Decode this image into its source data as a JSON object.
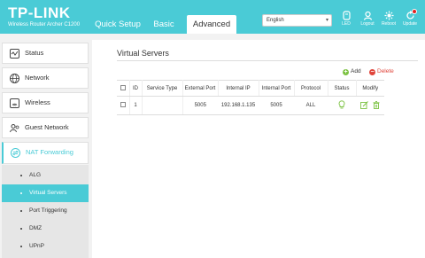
{
  "brand": {
    "logo": "TP-LINK",
    "model": "Wireless Router Archer C1200"
  },
  "tabs": [
    {
      "label": "Quick Setup"
    },
    {
      "label": "Basic"
    },
    {
      "label": "Advanced"
    }
  ],
  "language": {
    "selected": "English"
  },
  "header_buttons": [
    {
      "label": "LED",
      "icon": "led-icon"
    },
    {
      "label": "Logout",
      "icon": "logout-icon"
    },
    {
      "label": "Reboot",
      "icon": "reboot-icon"
    },
    {
      "label": "Update",
      "icon": "update-icon"
    }
  ],
  "sidebar": {
    "items": [
      {
        "label": "Status",
        "icon": "status-icon"
      },
      {
        "label": "Network",
        "icon": "globe-icon"
      },
      {
        "label": "Wireless",
        "icon": "wireless-icon"
      },
      {
        "label": "Guest Network",
        "icon": "guest-icon"
      },
      {
        "label": "NAT Forwarding",
        "icon": "nat-icon"
      }
    ],
    "sub_items": [
      {
        "label": "ALG"
      },
      {
        "label": "Virtual Servers"
      },
      {
        "label": "Port Triggering"
      },
      {
        "label": "DMZ"
      },
      {
        "label": "UPnP"
      }
    ]
  },
  "main": {
    "title": "Virtual Servers",
    "add_label": "Add",
    "delete_label": "Delete",
    "help_label": "?",
    "columns": [
      "ID",
      "Service Type",
      "External Port",
      "Internal IP",
      "Internal Port",
      "Protocol",
      "Status",
      "Modify"
    ],
    "rows": [
      {
        "id": "1",
        "service_type": "",
        "external_port": "5005",
        "internal_ip": "192.168.1.135",
        "internal_port": "5005",
        "protocol": "ALL"
      }
    ]
  },
  "colors": {
    "accent": "#4acbd6",
    "add": "#7cc242",
    "delete": "#e0443a",
    "status_bulb": "#7cc242"
  }
}
